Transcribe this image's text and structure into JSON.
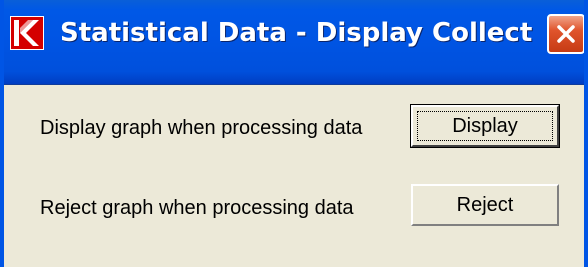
{
  "window": {
    "title": "Statistical Data - Display Collect",
    "app_icon": "red-k-logo-icon",
    "close_icon": "close-icon"
  },
  "rows": [
    {
      "label": "Display graph when processing data",
      "button_label": "Display"
    },
    {
      "label": "Reject graph when processing data",
      "button_label": "Reject"
    }
  ],
  "colors": {
    "titlebar": "#0054e3",
    "client_background": "#ece9d8",
    "close_button": "#e0542c",
    "icon_red": "#cc0000"
  }
}
